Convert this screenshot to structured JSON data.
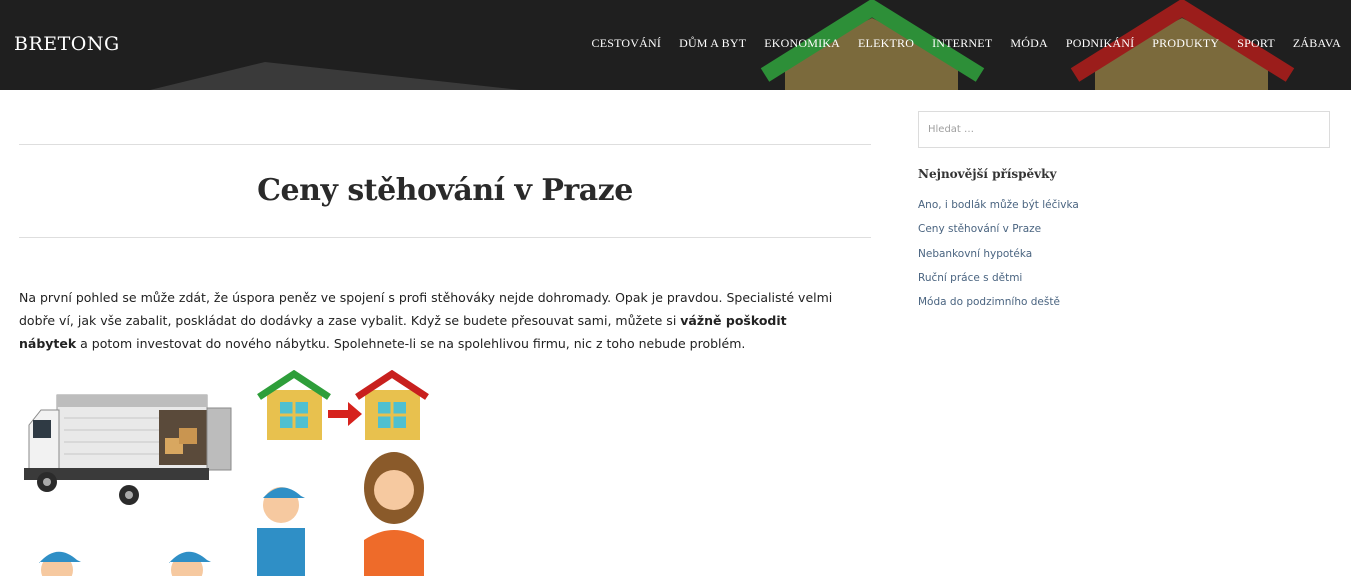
{
  "header": {
    "logo": "BRETONG",
    "nav": [
      "CESTOVÁNÍ",
      "DŮM A BYT",
      "EKONOMIKA",
      "ELEKTRO",
      "INTERNET",
      "MÓDA",
      "PODNIKÁNÍ",
      "PRODUKTY",
      "SPORT",
      "ZÁBAVA"
    ]
  },
  "article": {
    "title": "Ceny stěhování v Praze",
    "intro_before": "Na první pohled se může zdát, že úspora peněz ve spojení s profi stěhováky nejde dohromady. Opak je pravdou. Specialisté velmi dobře ví, jak vše zabalit, poskládat do dodávky a zase vybalit. Když se budete přesouvat sami, můžete si ",
    "intro_bold": "vážně poškodit nábytek",
    "intro_after": " a potom investovat do nového nábytku. Spolehnete-li se na spolehlivou firmu, nic z toho nebude problém."
  },
  "sidebar": {
    "search_placeholder": "Hledat …",
    "widget_title": "Nejnovější příspěvky",
    "posts": [
      "Ano, i bodlák může být léčivka",
      "Ceny stěhování v Praze",
      "Nebankovní hypotéka",
      "Ruční práce s dětmi",
      "Móda do podzimního deště"
    ]
  },
  "colors": {
    "header_bg": "#1f1f1f",
    "house_green_roof": "#2e9e3a",
    "house_red_roof": "#c8201e",
    "house_wall": "#e8c14e",
    "link": "#4a6480"
  }
}
